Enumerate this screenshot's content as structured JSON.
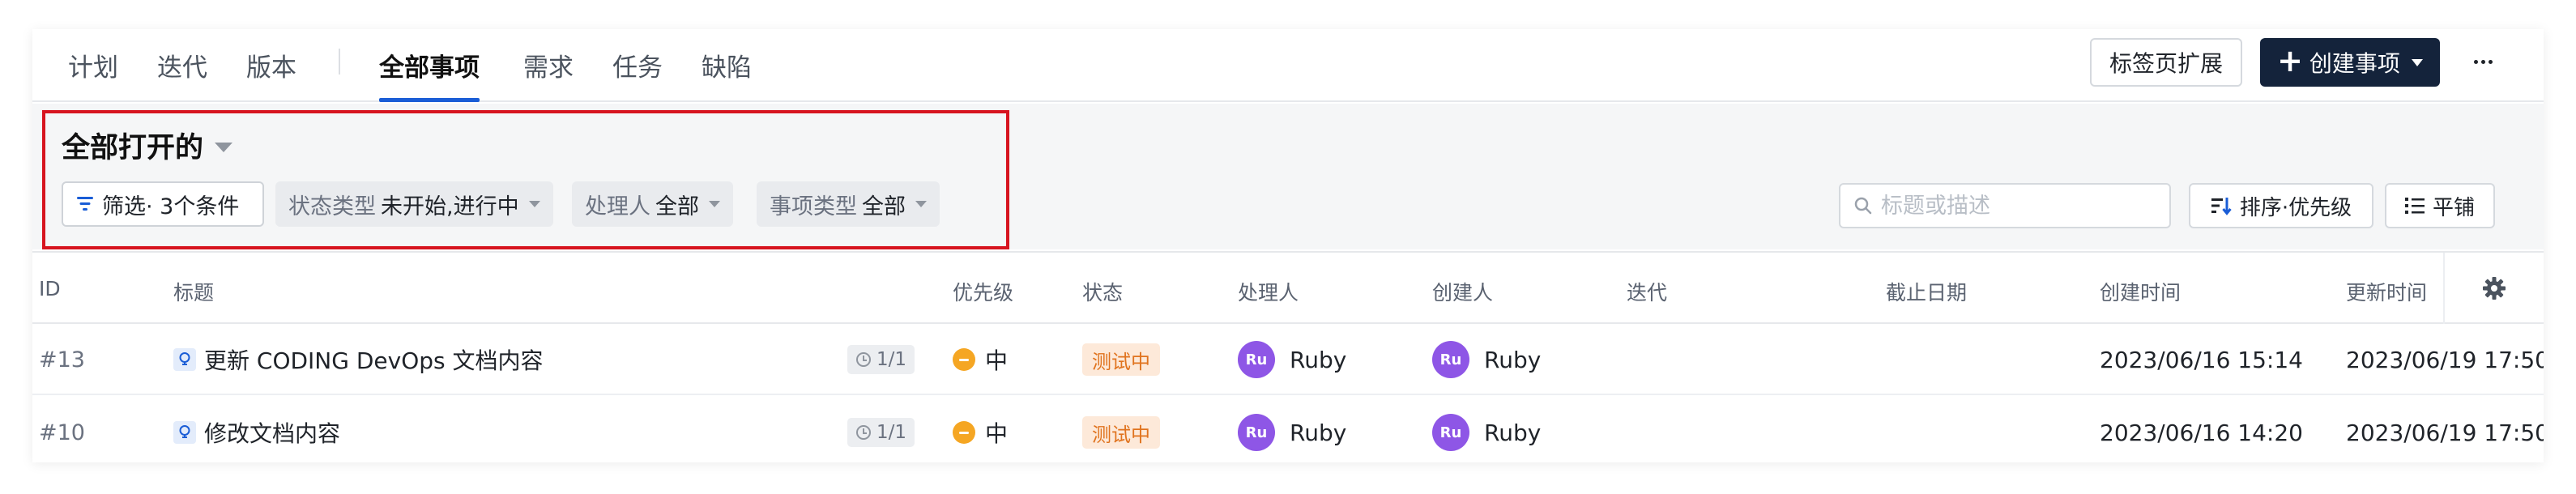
{
  "tabs": {
    "plan": "计划",
    "iteration": "迭代",
    "version": "版本",
    "all_items": "全部事项",
    "requirements": "需求",
    "tasks": "任务",
    "defects": "缺陷"
  },
  "toolbar": {
    "tab_extension_label": "标签页扩展",
    "create_label": "创建事项",
    "more_label": "更多"
  },
  "view": {
    "title": "全部打开的"
  },
  "filters": {
    "filter_label": "筛选· 3个条件",
    "status_type_label": "状态类型",
    "status_type_value": "未开始,进行中",
    "assignee_label": "处理人",
    "assignee_value": "全部",
    "item_type_label": "事项类型",
    "item_type_value": "全部"
  },
  "search": {
    "placeholder": "标题或描述"
  },
  "sort": {
    "label": "排序·优先级"
  },
  "layout_toggle": {
    "label": "平铺"
  },
  "table": {
    "columns": {
      "id": "ID",
      "title": "标题",
      "priority": "优先级",
      "status": "状态",
      "assignee": "处理人",
      "creator": "创建人",
      "iteration": "迭代",
      "due_date": "截止日期",
      "created_at": "创建时间",
      "updated_at": "更新时间"
    },
    "rows": [
      {
        "id": "#13",
        "title": "更新 CODING DevOps 文档内容",
        "subtasks": "1/1",
        "priority": "中",
        "status": "测试中",
        "assignee_initials": "Ru",
        "assignee": "Ruby",
        "creator_initials": "Ru",
        "creator": "Ruby",
        "iteration": "",
        "due_date": "",
        "created_at": "2023/06/16 15:14",
        "updated_at": "2023/06/19 17:50"
      },
      {
        "id": "#10",
        "title": "修改文档内容",
        "subtasks": "1/1",
        "priority": "中",
        "status": "测试中",
        "assignee_initials": "Ru",
        "assignee": "Ruby",
        "creator_initials": "Ru",
        "creator": "Ruby",
        "iteration": "",
        "due_date": "",
        "created_at": "2023/06/16 14:20",
        "updated_at": "2023/06/19 17:50"
      }
    ]
  },
  "colors": {
    "accent": "#1a5dd6",
    "create_button": "#14233b",
    "highlight_border": "#d7141f",
    "priority_medium": "#f5a623",
    "status_testing_bg": "#fde9d9",
    "status_testing_text": "#e0731e",
    "avatar": "#8e56e6"
  },
  "icons": {
    "create": "plus-icon",
    "more": "more-horizontal-icon",
    "filter": "filter-icon",
    "search": "search-icon",
    "sort": "sort-icon",
    "layout": "list-icon",
    "settings": "gear-icon",
    "requirement": "lightbulb-icon",
    "subtask": "subtask-icon"
  }
}
